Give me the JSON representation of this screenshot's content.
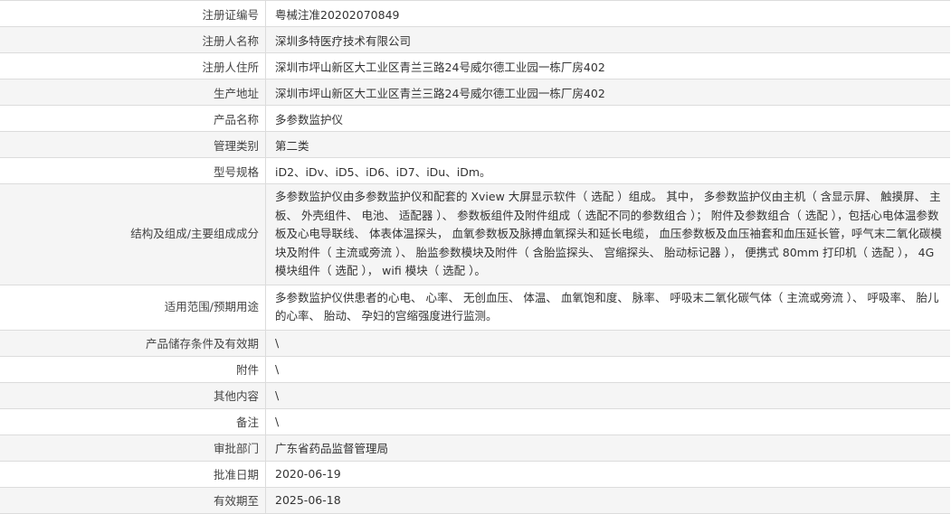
{
  "rows": [
    {
      "label": "注册证编号",
      "value": "粤械注准20202070849"
    },
    {
      "label": "注册人名称",
      "value": "深圳多特医疗技术有限公司"
    },
    {
      "label": "注册人住所",
      "value": "深圳市坪山新区大工业区青兰三路24号威尔德工业园一栋厂房402"
    },
    {
      "label": "生产地址",
      "value": "深圳市坪山新区大工业区青兰三路24号威尔德工业园一栋厂房402"
    },
    {
      "label": "产品名称",
      "value": "多参数监护仪"
    },
    {
      "label": "管理类别",
      "value": "第二类"
    },
    {
      "label": "型号规格",
      "value": "iD2、iDv、iD5、iD6、iD7、iDu、iDm。"
    },
    {
      "label": "结构及组成/主要组成成分",
      "value": "多参数监护仪由多参数监护仪和配套的 Xview 大屏显示软件（ 选配 ）组成。 其中， 多参数监护仪由主机（ 含显示屏、 触摸屏、 主板、 外壳组件、 电池、 适配器 ）、 参数板组件及附件组成（ 选配不同的参数组合 ）； 附件及参数组合（ 选配 ），包括心电体温参数板及心电导联线、 体表体温探头， 血氧参数板及脉搏血氧探头和延长电缆， 血压参数板及血压袖套和血压延长管，呼气末二氧化碳模块及附件（ 主流或旁流 ）、 胎监参数模块及附件（ 含胎监探头、 宫缩探头、 胎动标记器 ）， 便携式 80mm 打印机（ 选配 ）， 4G 模块组件（ 选配 ）， wifi 模块（ 选配 ）。"
    },
    {
      "label": "适用范围/预期用途",
      "value": "多参数监护仪供患者的心电、 心率、 无创血压、 体温、 血氧饱和度、 脉率、 呼吸末二氧化碳气体（ 主流或旁流 ）、 呼吸率、 胎儿的心率、 胎动、 孕妇的宫缩强度进行监测。"
    },
    {
      "label": "产品储存条件及有效期",
      "value": "\\"
    },
    {
      "label": "附件",
      "value": "\\"
    },
    {
      "label": "其他内容",
      "value": "\\"
    },
    {
      "label": "备注",
      "value": "\\"
    },
    {
      "label": "审批部门",
      "value": "广东省药品监督管理局"
    },
    {
      "label": "批准日期",
      "value": "2020-06-19"
    },
    {
      "label": "有效期至",
      "value": "2025-06-18"
    }
  ]
}
